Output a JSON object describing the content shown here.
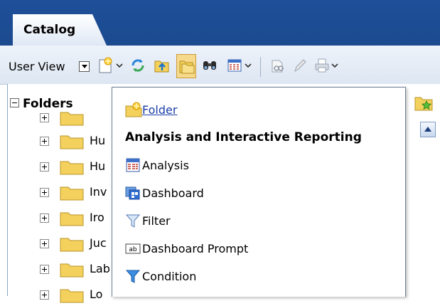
{
  "header": {
    "tab_label": "Catalog"
  },
  "toolbar": {
    "user_view_label": "User View",
    "icons": [
      "new-item-icon",
      "refresh-icon",
      "upload-folder-icon",
      "show-folders-icon",
      "search-binoculars-icon",
      "view-options-icon",
      "preview-icon",
      "edit-icon",
      "print-icon"
    ]
  },
  "sidebar": {
    "title": "Folders",
    "items": [
      {
        "label": "Hu"
      },
      {
        "label": "Hu"
      },
      {
        "label": "Inv"
      },
      {
        "label": "Iro"
      },
      {
        "label": "Juc"
      },
      {
        "label": "Lab"
      },
      {
        "label": "Lo"
      }
    ]
  },
  "menu": {
    "folder_label": "Folder",
    "section_header": "Analysis and Interactive Reporting",
    "items": [
      {
        "label": "Analysis",
        "icon": "analysis-icon"
      },
      {
        "label": "Dashboard",
        "icon": "dashboard-icon"
      },
      {
        "label": "Filter",
        "icon": "filter-icon"
      },
      {
        "label": "Dashboard Prompt",
        "icon": "prompt-abl-icon"
      },
      {
        "label": "Condition",
        "icon": "condition-filter-icon"
      }
    ]
  },
  "colors": {
    "header_blue": "#1e4f98",
    "link_blue": "#1a3ea8",
    "folder_yellow": "#f4d15c"
  }
}
